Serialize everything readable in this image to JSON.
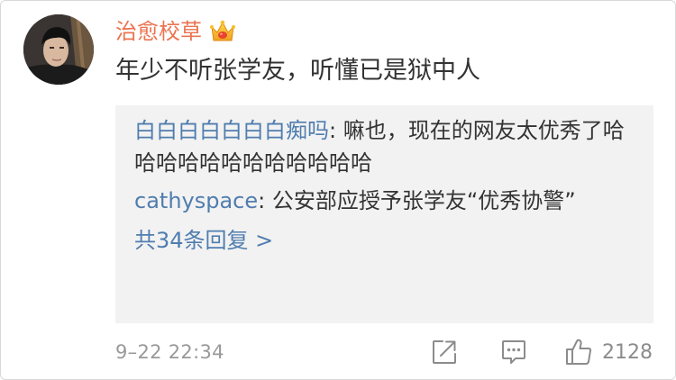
{
  "comment": {
    "author": "治愈校草",
    "author_badge_icon": "crown-icon",
    "text": "年少不听张学友，听懂已是狱中人",
    "timestamp": "9–22 22:34",
    "like_count": "2128"
  },
  "replies": [
    {
      "name": "白白白白白白白痴吗",
      "separator": ":",
      "text": " 嘛也，现在的网友太优秀了哈哈哈哈哈哈哈哈哈哈哈哈"
    },
    {
      "name": "cathyspace",
      "separator": ":",
      "text": " 公安部应授予张学友“优秀协警”"
    }
  ],
  "more_replies_label": "共34条回复 >",
  "colors": {
    "author": "#eb7350",
    "link_blue": "#507daf",
    "body_text": "#333333",
    "reply_bg": "#f2f2f2",
    "meta_gray": "#999999"
  },
  "icons": {
    "share": "share-icon",
    "comment": "comment-icon",
    "like": "thumbs-up-icon"
  }
}
